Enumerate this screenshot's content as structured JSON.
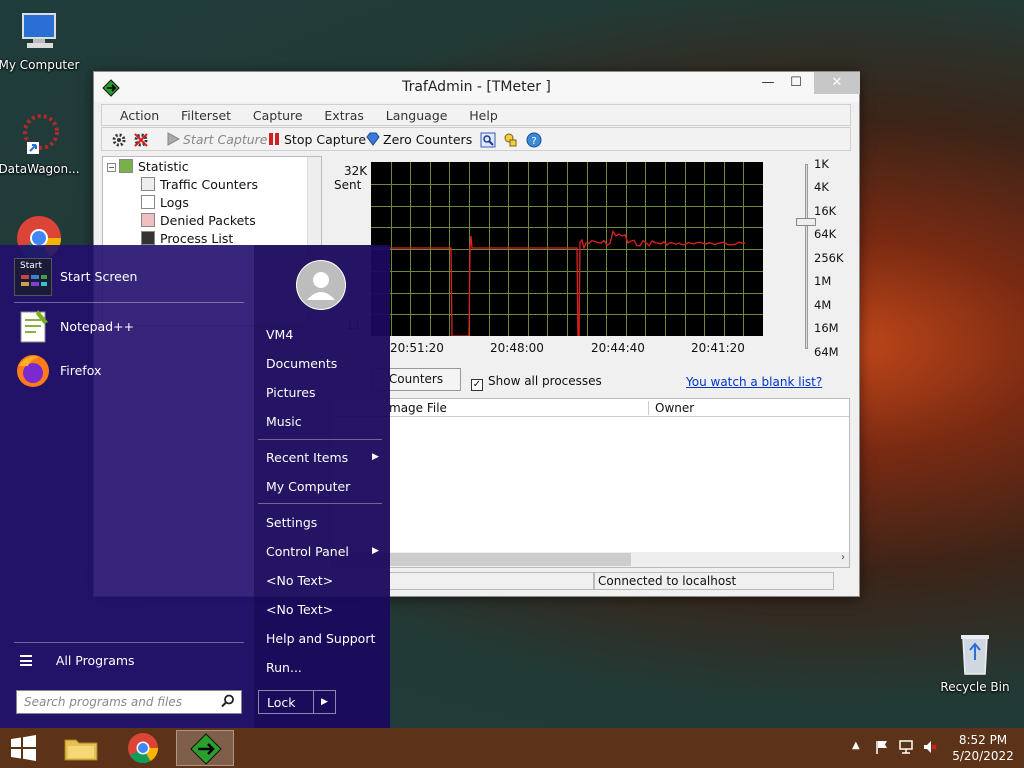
{
  "desktop": {
    "icons": {
      "my_computer": "My Computer",
      "datawagon": "DataWagon...",
      "recycle_bin": "Recycle Bin"
    }
  },
  "window": {
    "title": "TrafAdmin - [TMeter ]",
    "controls": {
      "minimize": "—",
      "maximize": "☐",
      "close": "✕"
    },
    "menu": [
      "Action",
      "Filterset",
      "Capture",
      "Extras",
      "Language",
      "Help"
    ],
    "toolbar": {
      "start_capture": "Start Capture",
      "stop_capture": "Stop Capture",
      "zero_counters": "Zero Counters"
    },
    "tree": {
      "root": "Statistic",
      "items": [
        "Traffic Counters",
        "Logs",
        "Denied Packets",
        "Process List"
      ]
    },
    "graph": {
      "y_top": "32K",
      "y_sub": "Sent",
      "y_mid_partial": "11",
      "x_ticks": [
        "20:51:20",
        "20:48:00",
        "20:44:40",
        "20:41:20"
      ],
      "scale": [
        "1K",
        "4K",
        "16K",
        "64K",
        "256K",
        "1M",
        "4M",
        "16M",
        "64M"
      ],
      "colors": {
        "line": "#e02020",
        "grid": "#6a8a3a",
        "bg": "#000000"
      }
    },
    "counters_button": "Counters",
    "show_all_processes": "Show all processes",
    "show_all_checked": "✓",
    "blank_list_link": "You watch a blank list?",
    "columns": [
      "mage File",
      "Owner"
    ],
    "status": "Connected to localhost"
  },
  "start_menu": {
    "pinned": [
      "Start Screen",
      "Notepad++",
      "Firefox"
    ],
    "start_tile_label": "Start",
    "all_programs": "All Programs",
    "search_placeholder": "Search programs and files",
    "right_items": {
      "user": "VM4",
      "documents": "Documents",
      "pictures": "Pictures",
      "music": "Music",
      "recent_items": "Recent Items",
      "my_computer": "My Computer",
      "settings": "Settings",
      "control_panel": "Control Panel",
      "no_text_1": "<No Text>",
      "no_text_2": "<No Text>",
      "help_support": "Help and Support",
      "run": "Run..."
    },
    "lock": "Lock",
    "arrow": "▶"
  },
  "taskbar": {
    "time": "8:52 PM",
    "date": "5/20/2022"
  }
}
